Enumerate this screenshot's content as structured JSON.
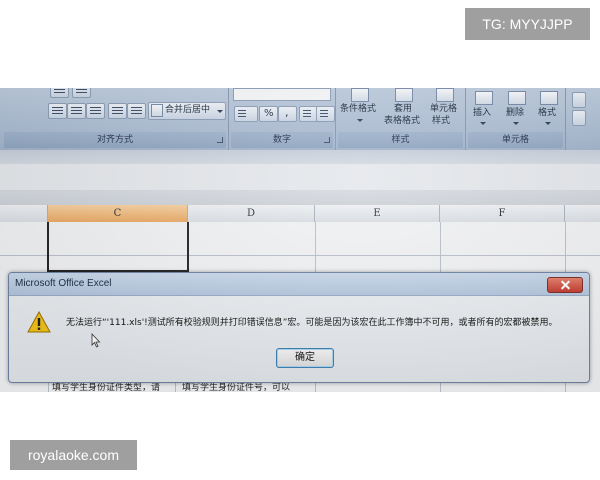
{
  "watermarks": {
    "top_right": "TG: MYYJJPP",
    "bottom_left": "royalaoke.com"
  },
  "ribbon": {
    "alignment": {
      "merge_center": "合并后居中",
      "group_label": "对齐方式"
    },
    "number": {
      "percent": "%",
      "comma": ",",
      "group_label": "数字"
    },
    "styles": {
      "conditional_format": "条件格式",
      "table_format_line1": "套用",
      "table_format_line2": "表格格式",
      "cell_style_line1": "单元格",
      "cell_style_line2": "样式",
      "group_label": "样式"
    },
    "cells": {
      "insert": "插入",
      "delete": "删除",
      "format": "格式",
      "group_label": "单元格"
    }
  },
  "columns": [
    "C",
    "D",
    "E",
    "F"
  ],
  "selected_column_index": 0,
  "dialog": {
    "title": "Microsoft Office Excel",
    "icon": "warning-icon",
    "message": "无法运行“'111.xls'!测试所有校验规则并打印错误信息”宏。可能是因为该宏在此工作簿中不可用，或者所有的宏都被禁用。",
    "ok_label": "确定"
  },
  "cells_text": [
    "填写学生身份证件类型，请",
    "填写学生身份证件号，可以"
  ],
  "colors": {
    "ribbon": "#aabbd1",
    "selected_column": "#e8a862",
    "dialog_title": "#b3c6de",
    "close_button": "#c2392c",
    "warning": "#f2c21b",
    "watermark_bg": "#9f9f9f"
  }
}
